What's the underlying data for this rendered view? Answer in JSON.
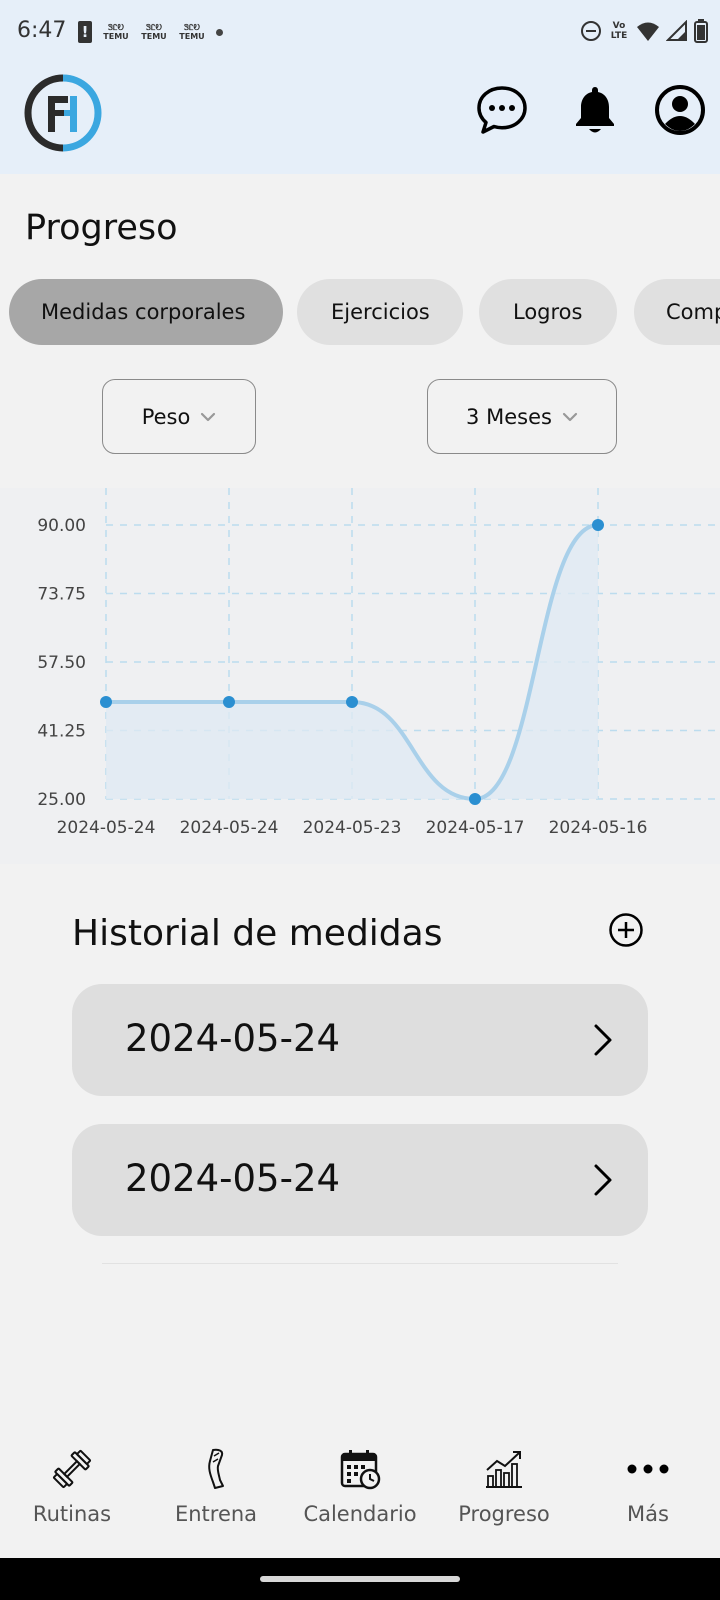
{
  "status_bar": {
    "time": "6:47",
    "alert_icon": "!",
    "notification_badges": [
      "ᏕᏝᎧ TEMU",
      "ᏕᏝᎧ TEMU",
      "ᏕᏝᎧ TEMU"
    ],
    "volte": "Vo LTE"
  },
  "app_bar": {
    "logo": "FH",
    "icons": [
      "chat-bubble-icon",
      "bell-icon",
      "account-icon"
    ]
  },
  "page": {
    "title": "Progreso"
  },
  "tabs": [
    {
      "label": "Medidas corporales",
      "active": true
    },
    {
      "label": "Ejercicios",
      "active": false
    },
    {
      "label": "Logros",
      "active": false
    },
    {
      "label": "Comp",
      "active": false
    }
  ],
  "filters": {
    "metric": "Peso",
    "range": "3 Meses"
  },
  "chart_data": {
    "type": "line",
    "title": "",
    "xlabel": "",
    "ylabel": "",
    "categories": [
      "2024-05-24",
      "2024-05-24",
      "2024-05-23",
      "2024-05-17",
      "2024-05-16"
    ],
    "values": [
      48,
      48,
      48,
      25,
      90
    ],
    "y_ticks": [
      "90.00",
      "73.75",
      "57.50",
      "41.25",
      "25.00"
    ],
    "ylim": [
      25,
      90
    ],
    "curve": "smooth",
    "area_fill": true,
    "grid": "dashed",
    "colors": {
      "line": "#a9d0ea",
      "point": "#2b8fd1",
      "grid": "#bcdcee",
      "area": "#dfe9f3"
    }
  },
  "history": {
    "title": "Historial de medidas",
    "items": [
      {
        "date": "2024-05-24"
      },
      {
        "date": "2024-05-24"
      }
    ]
  },
  "bottom_nav": [
    {
      "label": "Rutinas",
      "icon": "dumbbell-icon"
    },
    {
      "label": "Entrena",
      "icon": "leg-icon"
    },
    {
      "label": "Calendario",
      "icon": "calendar-clock-icon"
    },
    {
      "label": "Progreso",
      "icon": "chart-growth-icon"
    },
    {
      "label": "Más",
      "icon": "more-dots-icon"
    }
  ]
}
